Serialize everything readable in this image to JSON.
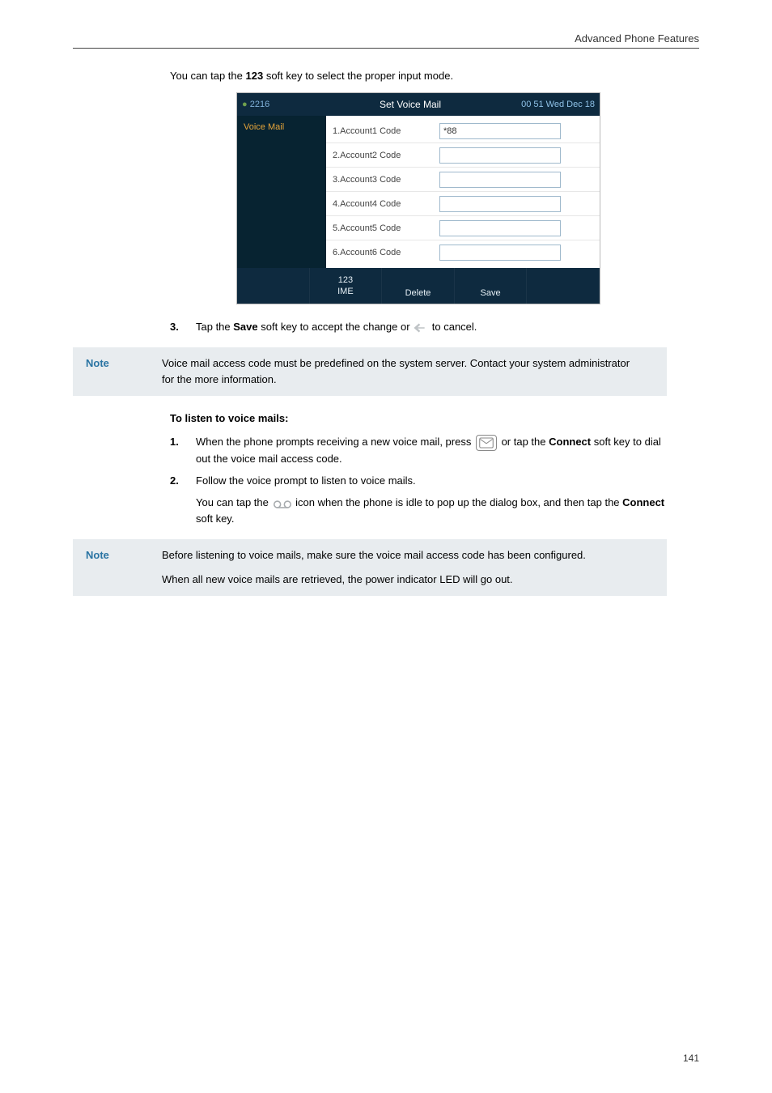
{
  "header": {
    "title": "Advanced Phone Features"
  },
  "intro": {
    "prefix": "You can tap the ",
    "key": "123",
    "suffix": " soft key to select the proper input mode."
  },
  "screenshot": {
    "header_left": "2216",
    "header_title": "Set Voice Mail",
    "header_time": "00 51 Wed Dec 18",
    "left_item": "Voice Mail",
    "rows": [
      {
        "label": "1.Account1 Code",
        "value": "*88"
      },
      {
        "label": "2.Account2 Code",
        "value": ""
      },
      {
        "label": "3.Account3 Code",
        "value": ""
      },
      {
        "label": "4.Account4 Code",
        "value": ""
      },
      {
        "label": "5.Account5 Code",
        "value": ""
      },
      {
        "label": "6.Account6 Code",
        "value": ""
      }
    ],
    "footer": {
      "ime_top": "123",
      "ime_bottom": "IME",
      "delete": "Delete",
      "save": "Save"
    }
  },
  "step3": {
    "num": "3.",
    "pre": "Tap the ",
    "bold1": "Save",
    "mid": " soft key to accept the change or ",
    "post": " to cancel."
  },
  "note1": {
    "label": "Note",
    "text": "Voice mail access code must be predefined on the system server. Contact your system administrator for the more information."
  },
  "listen": {
    "heading": "To listen to voice mails:",
    "step1": {
      "num": "1.",
      "pre": "When the phone prompts receiving a new voice mail, press ",
      "post": " or tap the ",
      "bold": "Connect",
      "tail": " soft key to dial out the voice mail access code."
    },
    "step2": {
      "num": "2.",
      "text": "Follow the voice prompt to listen to voice mails."
    },
    "sub": {
      "pre": "You can tap the ",
      "mid": " icon when the phone is idle to pop up the dialog box, and then tap the ",
      "bold": "Connect",
      "post": " soft key."
    }
  },
  "note2": {
    "label": "Note",
    "p1": "Before listening to voice mails, make sure the voice mail access code has been configured.",
    "p2": "When all new voice mails are retrieved, the power indicator LED will go out."
  },
  "page_number": "141"
}
